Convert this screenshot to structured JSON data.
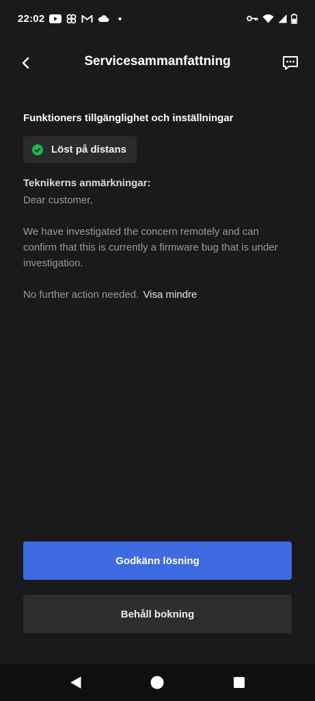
{
  "status_bar": {
    "time": "22:02",
    "notification_icons": [
      "youtube-icon",
      "pinwheel-icon",
      "gmail-icon",
      "cloud-icon",
      "dot-icon"
    ],
    "system_icons": [
      "vpn-key-icon",
      "wifi-icon",
      "cellular-signal-icon",
      "battery-icon"
    ]
  },
  "header": {
    "title": "Servicesammanfattning",
    "back_icon": "chevron-left-icon",
    "chat_icon": "message-icon"
  },
  "content": {
    "section_title": "Funktioners tillgänglighet och inställningar",
    "status_chip": {
      "label": "Löst på distans",
      "icon": "check-circle-icon",
      "color": "#1db954"
    },
    "notes_title": "Teknikerns anmärkningar:",
    "notes": {
      "line1": "Dear customer,",
      "line2": "We have investigated the concern remotely and can confirm that this is currently a firmware bug that is under investigation.",
      "line3": "No further action needed.",
      "show_less": "Visa mindre"
    }
  },
  "actions": {
    "primary_label": "Godkänn lösning",
    "secondary_label": "Behåll bokning",
    "primary_color": "#3e6ae1"
  },
  "nav_bar": {
    "icons": [
      "back-triangle-icon",
      "home-circle-icon",
      "recents-square-icon"
    ]
  }
}
